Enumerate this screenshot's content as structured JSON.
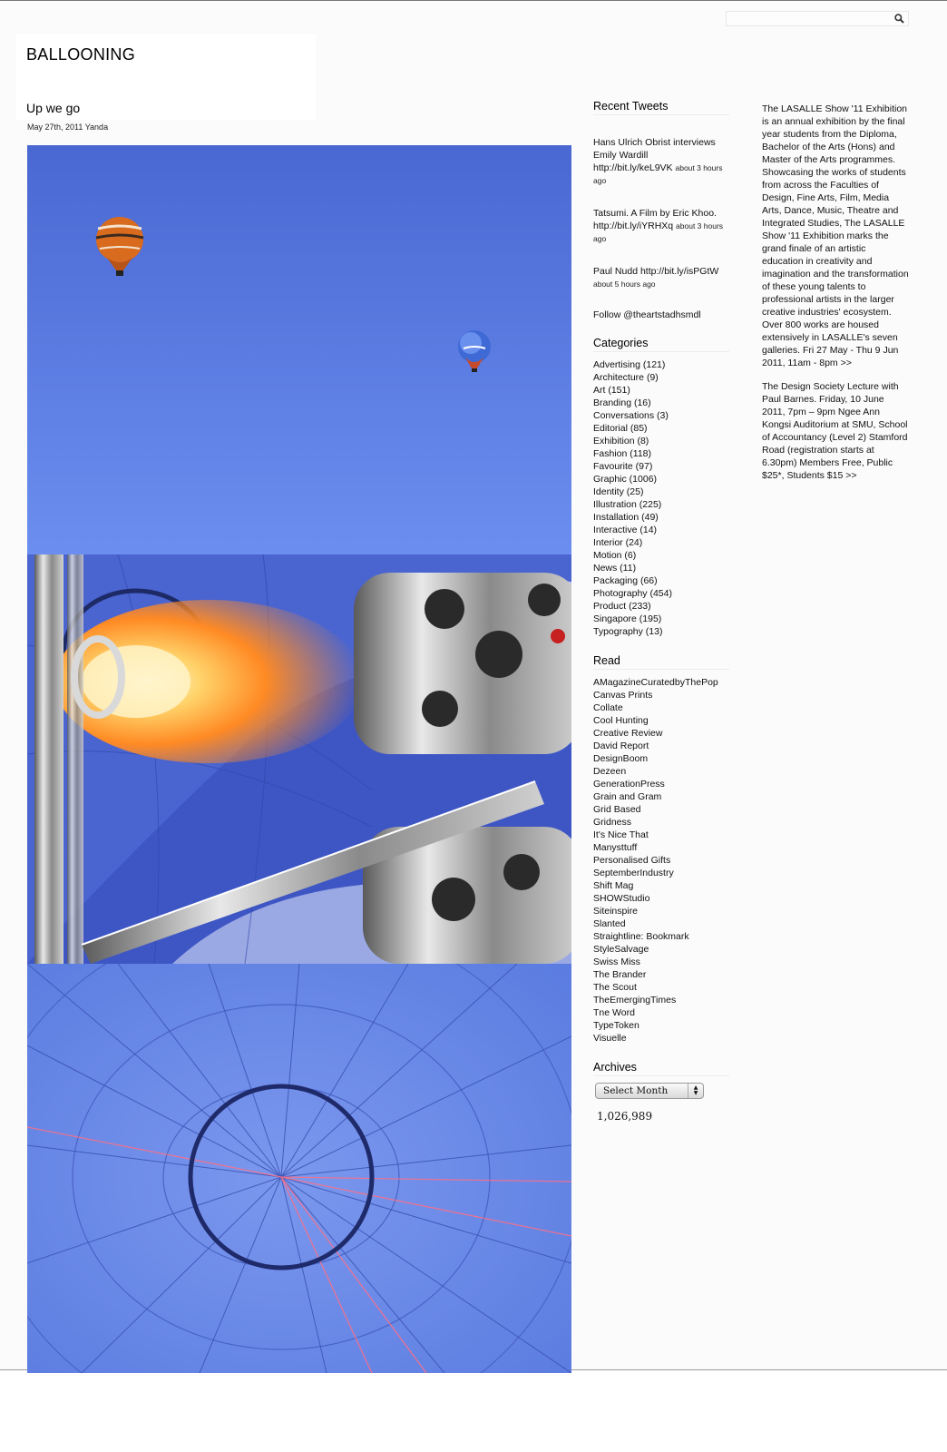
{
  "search": {
    "placeholder": ""
  },
  "site": {
    "title": "BALLOONING"
  },
  "post": {
    "title": "Up we go",
    "meta": "May 27th, 2011 Yanda"
  },
  "images": [
    {
      "name": "sky-with-balloons"
    },
    {
      "name": "balloon-burner-flame"
    },
    {
      "name": "balloon-envelope-interior"
    }
  ],
  "sidebar": {
    "tweets_title": "Recent Tweets",
    "tweets": [
      {
        "text": "Hans Ulrich Obrist interviews Emily Wardill http://bit.ly/keL9VK",
        "time": "about 3 hours ago"
      },
      {
        "text": "Tatsumi. A Film by Eric Khoo. http://bit.ly/iYRHXq",
        "time": "about 3 hours ago"
      },
      {
        "text": "Paul Nudd http://bit.ly/isPGtW",
        "time": "about 5 hours ago"
      }
    ],
    "follow": "Follow @theartstadhsmdl",
    "categories_title": "Categories",
    "categories": [
      "Advertising (121)",
      "Architecture (9)",
      "Art (151)",
      "Branding (16)",
      "Conversations (3)",
      "Editorial (85)",
      "Exhibition (8)",
      "Fashion (118)",
      "Favourite (97)",
      "Graphic (1006)",
      "Identity (25)",
      "Illustration (225)",
      "Installation (49)",
      "Interactive (14)",
      "Interior (24)",
      "Motion (6)",
      "News (11)",
      "Packaging (66)",
      "Photography (454)",
      "Product (233)",
      "Singapore (195)",
      "Typography (13)"
    ],
    "read_title": "Read",
    "read": [
      "AMagazineCuratedbyThePop",
      "Canvas Prints",
      "Collate",
      "Cool Hunting",
      "Creative Review",
      "David Report",
      "DesignBoom",
      "Dezeen",
      "GenerationPress",
      "Grain and Gram",
      "Grid Based",
      "Gridness",
      "It's Nice That",
      "Manysttuff",
      "Personalised Gifts",
      "SeptemberIndustry",
      "Shift Mag",
      "SHOWStudio",
      "Siteinspire",
      "Slanted",
      "Straightline: Bookmark",
      "StyleSalvage",
      "Swiss Miss",
      "The Brander",
      "The Scout",
      "TheEmergingTimes",
      "Tne Word",
      "TypeToken",
      "Visuelle"
    ],
    "archives_title": "Archives",
    "archives_select": "Select Month",
    "counter": "1,026,989"
  },
  "right_col": {
    "p1": "The LASALLE Show '11 Exhibition is an annual exhibition by the final year students from the Diploma, Bachelor of the Arts (Hons) and Master of the Arts programmes. Showcasing the works of students from across the Faculties of Design, Fine Arts, Film, Media Arts, Dance, Music, Theatre and Integrated Studies, The LASALLE Show '11 Exhibition marks the grand finale of an artistic education in creativity and imagination and the transformation of these young talents to professional artists in the larger creative industries' ecosystem. Over 800 works are housed extensively in LASALLE's seven galleries. Fri 27 May - Thu 9 Jun 2011, 11am - 8pm >>",
    "p2": "The Design Society Lecture with Paul Barnes. Friday, 10 June 2011, 7pm – 9pm Ngee Ann Kongsi Auditorium at SMU, School of Accountancy (Level 2) Stamford Road (registration starts at 6.30pm) Members Free, Public $25*, Students $15 >>"
  },
  "colors": {
    "sky": "#4d73d8",
    "balloon_fabric": "#6f8de8",
    "flame": "#ff9a2e"
  }
}
